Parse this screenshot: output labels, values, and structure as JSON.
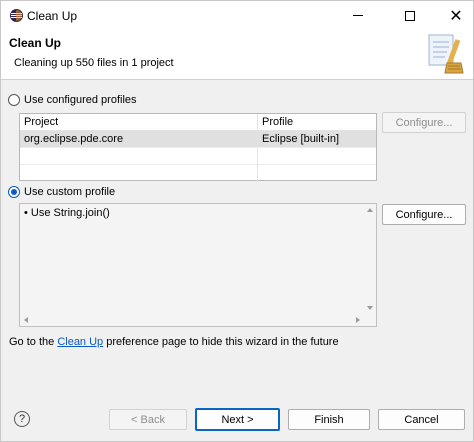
{
  "window": {
    "title": "Clean Up",
    "minimize_icon": "minimize-icon",
    "maximize_icon": "maximize-icon",
    "close_icon": "close-icon",
    "close_glyph": "✕"
  },
  "header": {
    "title": "Clean Up",
    "description": "Cleaning up 550 files in 1 project"
  },
  "configured": {
    "label": "Use configured profiles",
    "selected": false,
    "columns": [
      "Project",
      "Profile"
    ],
    "rows": [
      {
        "project": "org.eclipse.pde.core",
        "profile": "Eclipse [built-in]"
      }
    ],
    "configure_label": "Configure..."
  },
  "custom": {
    "label": "Use custom profile",
    "selected": true,
    "items": [
      "• Use String.join()"
    ],
    "configure_label": "Configure..."
  },
  "hint": {
    "prefix": "Go to the ",
    "link": "Clean Up",
    "suffix": " preference page to hide this wizard in the future"
  },
  "footer": {
    "help_glyph": "?",
    "back_label": "< Back",
    "next_label": "Next >",
    "finish_label": "Finish",
    "cancel_label": "Cancel"
  },
  "colors": {
    "accent": "#0a5bc4",
    "selected_row": "#e0e0e0"
  }
}
